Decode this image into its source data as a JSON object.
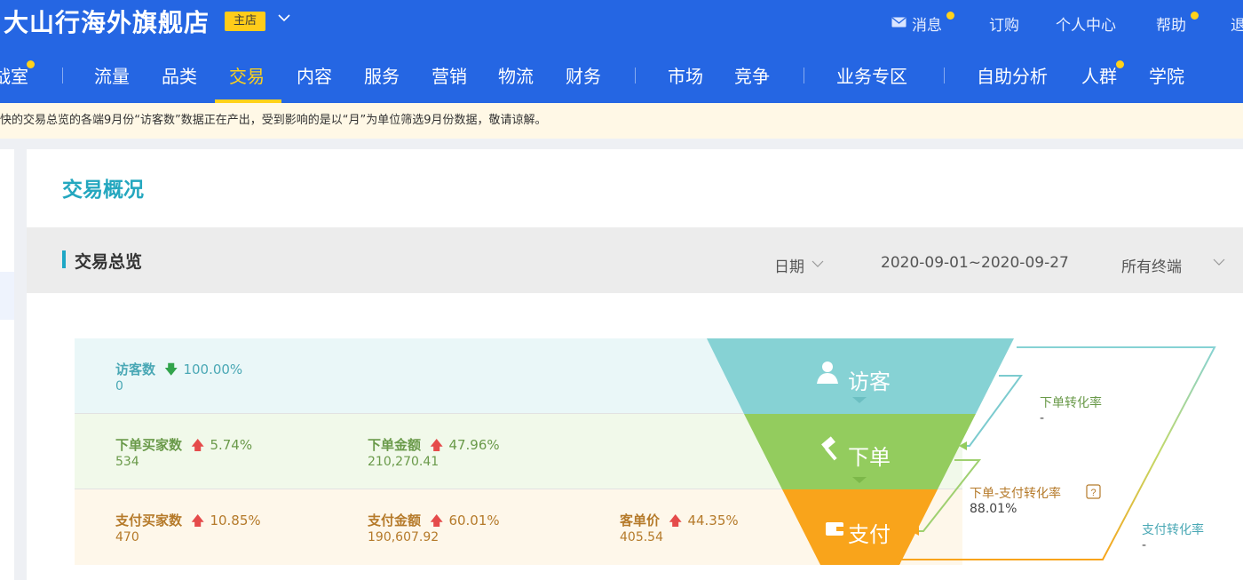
{
  "header": {
    "store_name": "大山行海外旗舰店",
    "store_badge": "主店",
    "links": [
      {
        "label": "消息"
      },
      {
        "label": "订购"
      },
      {
        "label": "个人中心"
      },
      {
        "label": "帮助"
      },
      {
        "label": "退"
      }
    ]
  },
  "nav": {
    "items": [
      {
        "label": "战室"
      },
      {
        "label": "流量"
      },
      {
        "label": "品类"
      },
      {
        "label": "交易",
        "active": true
      },
      {
        "label": "内容"
      },
      {
        "label": "服务"
      },
      {
        "label": "营销"
      },
      {
        "label": "物流"
      },
      {
        "label": "财务"
      },
      {
        "label": "市场"
      },
      {
        "label": "竞争"
      },
      {
        "label": "业务专区"
      },
      {
        "label": "自助分析"
      },
      {
        "label": "人群"
      },
      {
        "label": "学院"
      }
    ]
  },
  "notice": "快的交易总览的各端9月份“访客数”数据正在产出，受到影响的是以“月”为单位筛选9月份数据，敬请谅解。",
  "page_title": "交易概况",
  "section": {
    "title": "交易总览",
    "date_filter": "日期",
    "date_range": "2020-09-01~2020-09-27",
    "terminal_filter": "所有终端"
  },
  "metrics": {
    "visitors": {
      "label": "访客数",
      "change": "100.00%",
      "direction": "down",
      "value": "0"
    },
    "order_buyers": {
      "label": "下单买家数",
      "change": "5.74%",
      "direction": "up",
      "value": "534"
    },
    "order_amount": {
      "label": "下单金额",
      "change": "47.96%",
      "direction": "up",
      "value": "210,270.41"
    },
    "pay_buyers": {
      "label": "支付买家数",
      "change": "10.85%",
      "direction": "up",
      "value": "470"
    },
    "pay_amount": {
      "label": "支付金额",
      "change": "60.01%",
      "direction": "up",
      "value": "190,607.92"
    },
    "avg_order": {
      "label": "客单价",
      "change": "44.35%",
      "direction": "up",
      "value": "405.54"
    }
  },
  "funnel": {
    "stages": [
      {
        "label": "访客",
        "color": "#86d2d4"
      },
      {
        "label": "下单",
        "color": "#93cc5e"
      },
      {
        "label": "支付",
        "color": "#f9a41b"
      }
    ],
    "rates": {
      "order_rate": {
        "label": "下单转化率",
        "value": "-"
      },
      "order_pay_rate": {
        "label": "下单-支付转化率",
        "value": "88.01%"
      },
      "pay_rate": {
        "label": "支付转化率",
        "value": "-"
      }
    }
  },
  "colors": {
    "brand_blue": "#2566e3",
    "accent_yellow": "#ffd21a",
    "teal": "#24a7bf",
    "up_red": "#e54b4b",
    "down_green": "#32a44c"
  }
}
